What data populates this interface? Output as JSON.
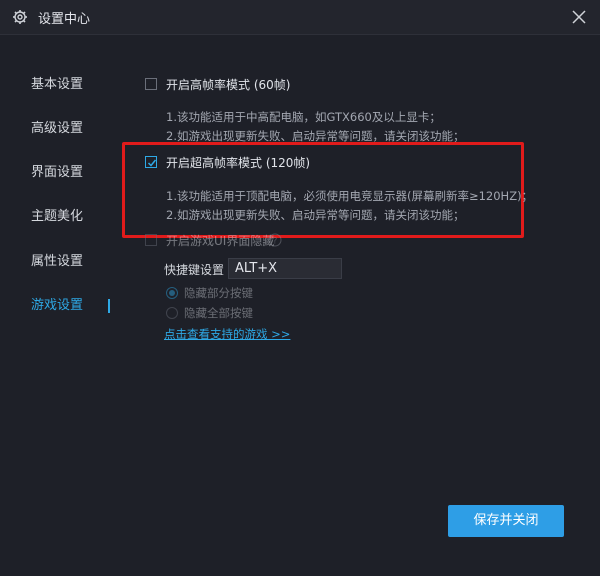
{
  "window": {
    "title": "设置中心"
  },
  "sidebar": {
    "items": [
      {
        "label": "基本设置"
      },
      {
        "label": "高级设置"
      },
      {
        "label": "界面设置"
      },
      {
        "label": "主题美化"
      },
      {
        "label": "属性设置"
      },
      {
        "label": "游戏设置",
        "active": true
      }
    ]
  },
  "game_settings": {
    "high_fps": {
      "label": "开启高帧率模式 (60帧)",
      "checked": false,
      "desc": [
        "1.该功能适用于中高配电脑，如GTX660及以上显卡；",
        "2.如游戏出现更新失败、启动异常等问题，请关闭该功能；"
      ]
    },
    "ultra_fps": {
      "label": "开启超高帧率模式 (120帧)",
      "checked": true,
      "desc": [
        "1.该功能适用于顶配电脑，必须使用电竞显示器(屏幕刷新率≥120HZ)；",
        "2.如游戏出现更新失败、启动异常等问题，请关闭该功能；"
      ]
    },
    "overlay": {
      "label": "开启游戏UI界面隐藏",
      "checked": false
    },
    "hotkey": {
      "label": "快捷键设置",
      "value": "ALT+X"
    },
    "hide_options": [
      {
        "label": "隐藏部分按键",
        "selected": true
      },
      {
        "label": "隐藏全部按键",
        "selected": false
      }
    ],
    "supported_games_link": "点击查看支持的游戏 >>"
  },
  "footer": {
    "save_label": "保存并关闭"
  },
  "colors": {
    "accent": "#2ea9e6",
    "highlight": "#e11b1b",
    "background": "#1e2028"
  }
}
